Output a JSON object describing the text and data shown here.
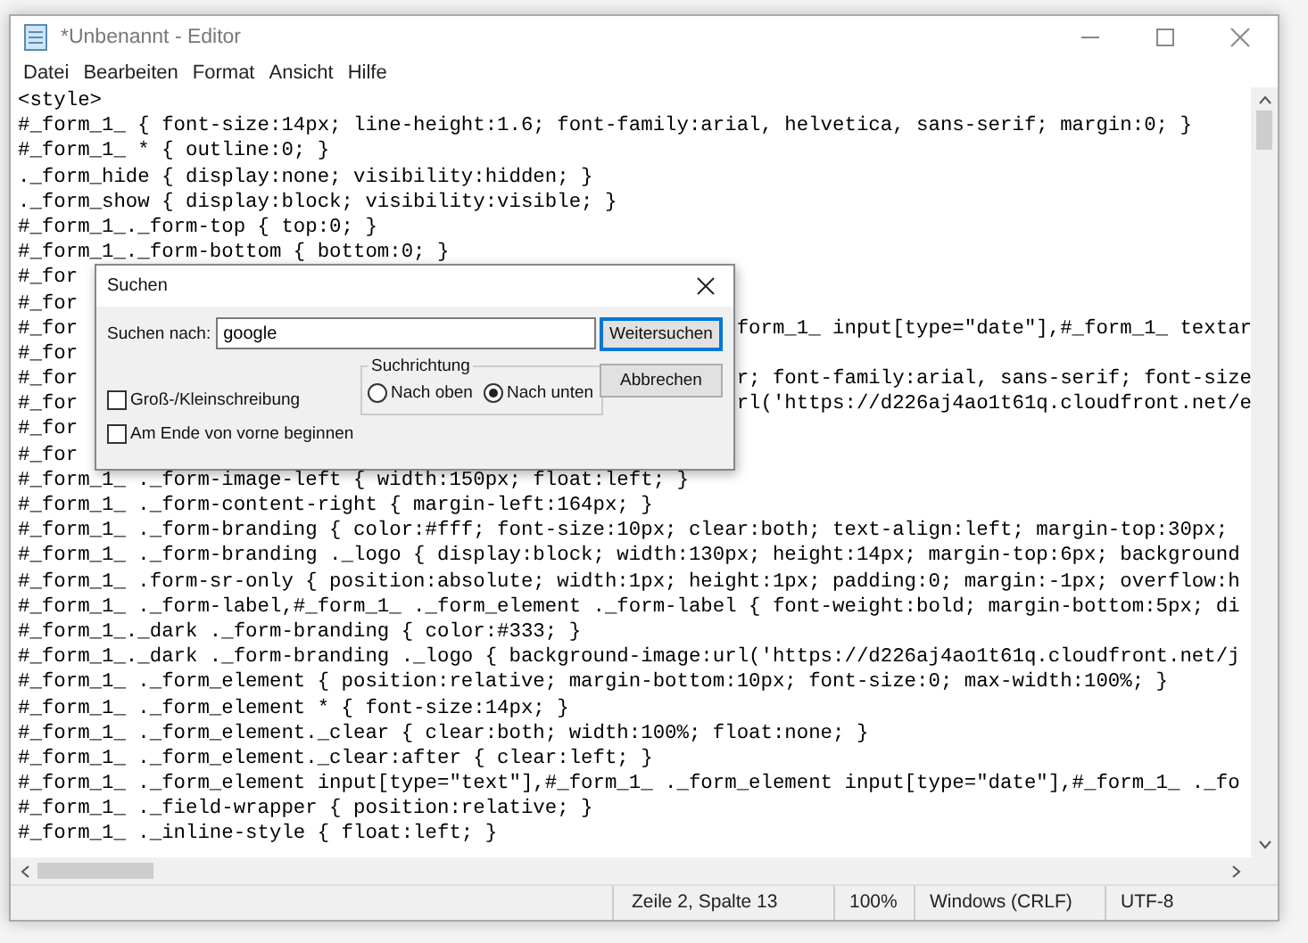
{
  "window": {
    "title": "*Unbenannt - Editor"
  },
  "menu": [
    "Datei",
    "Bearbeiten",
    "Format",
    "Ansicht",
    "Hilfe"
  ],
  "lines": [
    {
      "text": "<style>"
    },
    {
      "text": "#_form_1_ { font-size:14px; line-height:1.6; font-family:arial, helvetica, sans-serif; margin:0; }"
    },
    {
      "text": "#_form_1_ * { outline:0; }"
    },
    {
      "text": "._form_hide { display:none; visibility:hidden; }"
    },
    {
      "text": "._form_show { display:block; visibility:visible; }"
    },
    {
      "text": "#_form_1_._form-top { top:0; }"
    },
    {
      "text": "#_form_1_._form-bottom { bottom:0; }"
    },
    {
      "text": "#_for"
    },
    {
      "text": "#_for"
    },
    {
      "text": "#_for",
      "tail": "form_1_ input[type=\"date\"],#_form_1_ textar"
    },
    {
      "text": "#_for"
    },
    {
      "text": "#_for",
      "tail": "r; font-family:arial, sans-serif; font-size"
    },
    {
      "text": "#_for",
      "tail": "rl('https://d226aj4ao1t61q.cloudfront.net/e"
    },
    {
      "text": "#_for"
    },
    {
      "text": "#_for"
    },
    {
      "text": "#_form_1_ ._form-image-left { width:150px; float:left; }"
    },
    {
      "text": "#_form_1_ ._form-content-right { margin-left:164px; }"
    },
    {
      "text": "#_form_1_ ._form-branding { color:#fff; font-size:10px; clear:both; text-align:left; margin-top:30px;"
    },
    {
      "text": "#_form_1_ ._form-branding ._logo { display:block; width:130px; height:14px; margin-top:6px; background"
    },
    {
      "text": "#_form_1_ .form-sr-only { position:absolute; width:1px; height:1px; padding:0; margin:-1px; overflow:h"
    },
    {
      "text": "#_form_1_ ._form-label,#_form_1_ ._form_element ._form-label { font-weight:bold; margin-bottom:5px; di"
    },
    {
      "text": "#_form_1_._dark ._form-branding { color:#333; }"
    },
    {
      "text": "#_form_1_._dark ._form-branding ._logo { background-image:url('https://d226aj4ao1t61q.cloudfront.net/j"
    },
    {
      "text": "#_form_1_ ._form_element { position:relative; margin-bottom:10px; font-size:0; max-width:100%; }"
    },
    {
      "text": "#_form_1_ ._form_element * { font-size:14px; }"
    },
    {
      "text": "#_form_1_ ._form_element._clear { clear:both; width:100%; float:none; }"
    },
    {
      "text": "#_form_1_ ._form_element._clear:after { clear:left; }"
    },
    {
      "text": "#_form_1_ ._form_element input[type=\"text\"],#_form_1_ ._form_element input[type=\"date\"],#_form_1_ ._fo"
    },
    {
      "text": "#_form_1_ ._field-wrapper { position:relative; }"
    },
    {
      "text": "#_form_1_ ._inline-style { float:left; }"
    }
  ],
  "status_bar": [
    "Zeile 2, Spalte 13",
    "100%",
    "Windows (CRLF)",
    "UTF-8"
  ],
  "dialog": {
    "title": "Suchen",
    "search_label": "Suchen nach:",
    "search_value": "google",
    "buttons": [
      "Weitersuchen",
      "Abbrechen"
    ],
    "direction": {
      "label": "Suchrichtung",
      "options": [
        {
          "label": "Nach oben",
          "selected": false
        },
        {
          "label": "Nach unten",
          "selected": true
        }
      ]
    },
    "options": [
      {
        "label": "Groß-/Kleinschreibung",
        "checked": false
      },
      {
        "label": "Am Ende von vorne beginnen",
        "checked": false
      }
    ]
  }
}
